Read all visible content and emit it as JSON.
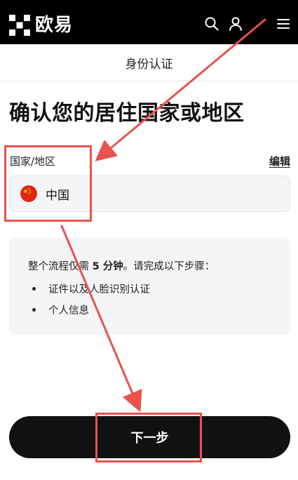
{
  "header": {
    "brand": "欧易",
    "icons": [
      "search-icon",
      "user-icon",
      "menu-icon"
    ]
  },
  "subheader": {
    "title": "身份认证"
  },
  "main": {
    "title": "确认您的居住国家或地区",
    "field_label": "国家/地区",
    "edit_label": "编辑",
    "country": {
      "name": "中国",
      "flag_icon": "china-flag-icon"
    },
    "info": {
      "prefix": "整个流程仅需 ",
      "duration": "5 分钟",
      "suffix": "。请完成以下步骤：",
      "steps": [
        "证件以及人脸识别认证",
        "个人信息"
      ]
    },
    "next_label": "下一步"
  },
  "colors": {
    "header_bg": "#000000",
    "card_bg": "#f5f5f7",
    "button_bg": "#111111",
    "annotation": "#e8524f"
  }
}
